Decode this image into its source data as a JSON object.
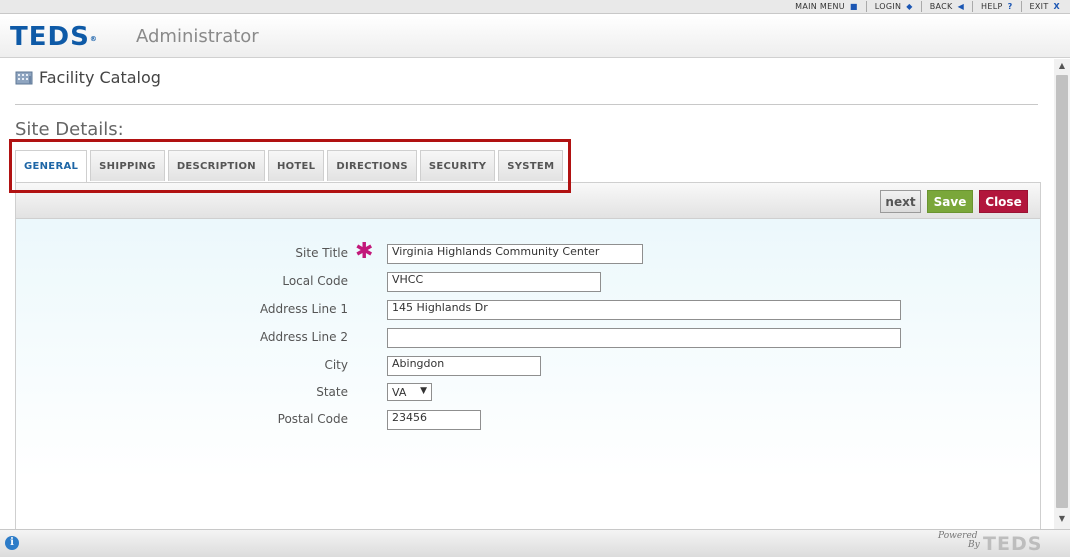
{
  "topnav": {
    "items": [
      {
        "label": "MAIN MENU",
        "icon": "■"
      },
      {
        "label": "LOGIN",
        "icon": "◆"
      },
      {
        "label": "BACK",
        "icon": "◀"
      },
      {
        "label": "HELP",
        "icon": "?"
      },
      {
        "label": "EXIT",
        "icon": "X"
      }
    ]
  },
  "header": {
    "logo": "TEDS",
    "subtitle": "Administrator"
  },
  "page": {
    "heading": "Facility Catalog",
    "section_title": "Site Details:"
  },
  "tabs": [
    {
      "label": "GENERAL",
      "active": true
    },
    {
      "label": "SHIPPING"
    },
    {
      "label": "DESCRIPTION"
    },
    {
      "label": "HOTEL"
    },
    {
      "label": "DIRECTIONS"
    },
    {
      "label": "SECURITY"
    },
    {
      "label": "SYSTEM"
    }
  ],
  "toolbar": {
    "next_label": "next",
    "save_label": "Save",
    "close_label": "Close"
  },
  "form": {
    "site_title": {
      "label": "Site Title",
      "value": "Virginia Highlands Community Center",
      "required_mark": "✱"
    },
    "local_code": {
      "label": "Local Code",
      "value": "VHCC"
    },
    "address_line_1": {
      "label": "Address Line 1",
      "value": "145 Highlands Dr"
    },
    "address_line_2": {
      "label": "Address Line 2",
      "value": ""
    },
    "city": {
      "label": "City",
      "value": "Abingdon"
    },
    "state": {
      "label": "State",
      "value": "VA"
    },
    "postal_code": {
      "label": "Postal Code",
      "value": "23456"
    }
  },
  "footer": {
    "powered_by_line1": "Powered",
    "powered_by_line2": "By",
    "logo": "TEDS",
    "info_icon": "i"
  },
  "colors": {
    "brand_blue": "#0e5aa7",
    "active_tab_text": "#1e66a6",
    "save_green": "#7aa73a",
    "close_red": "#b2163c",
    "highlight_red": "#b11212",
    "required_magenta": "#c2187a"
  }
}
